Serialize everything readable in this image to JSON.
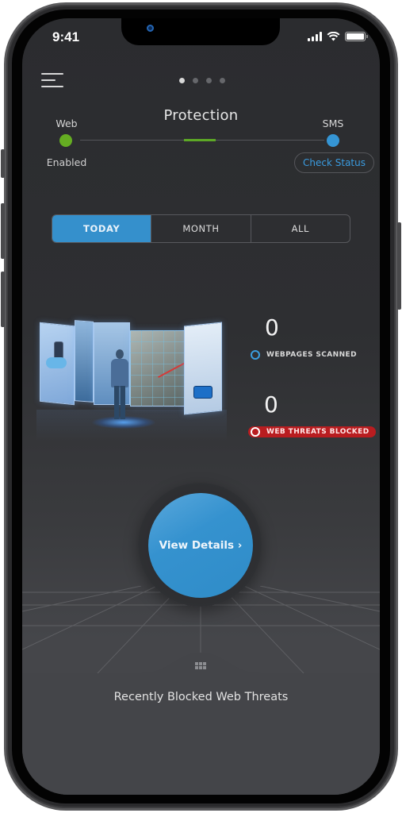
{
  "status_bar": {
    "time": "9:41",
    "icons": [
      "signal-icon",
      "wifi-icon",
      "battery-icon"
    ]
  },
  "header": {
    "menu_icon": "hamburger-menu-icon",
    "pager": {
      "total_pages": 4,
      "active_index": 0
    }
  },
  "protection": {
    "title": "Protection",
    "web": {
      "label": "Web",
      "status": "Enabled",
      "color": "#65ad22"
    },
    "sms": {
      "label": "SMS",
      "color": "#3595d4",
      "action_label": "Check Status"
    }
  },
  "period_tabs": {
    "items": [
      {
        "label": "TODAY",
        "active": true
      },
      {
        "label": "MONTH",
        "active": false
      },
      {
        "label": "ALL",
        "active": false
      }
    ],
    "accent": "#3590cc"
  },
  "stats": {
    "webpages_scanned": {
      "value": "0",
      "label": "WEBPAGES SCANNED",
      "color": "#3a9ee0"
    },
    "web_threats_blocked": {
      "value": "0",
      "label": "WEB THREATS BLOCKED",
      "color": "#b91d20"
    }
  },
  "illustration": {
    "description": "person-facing-web-panels-illustration"
  },
  "view_details": {
    "label": "View Details ›",
    "color": "#3592cf"
  },
  "bottom_sheet": {
    "handle_icon": "grid-handle-icon",
    "title": "Recently Blocked Web Threats"
  }
}
